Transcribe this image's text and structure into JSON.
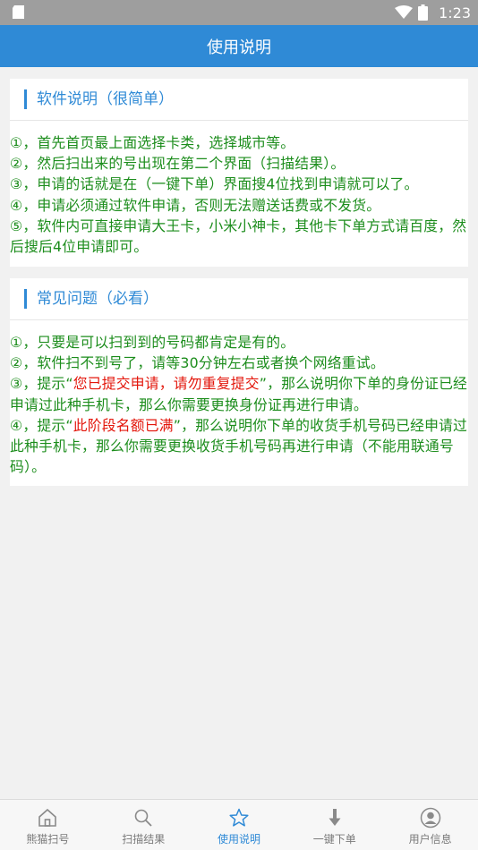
{
  "status_bar": {
    "time": "1:23",
    "icons": [
      "sd-card-icon",
      "wifi-icon",
      "battery-icon"
    ]
  },
  "app_bar": {
    "title": "使用说明"
  },
  "sections": [
    {
      "title": "软件说明（很简单）",
      "items": [
        "①，首先首页最上面选择卡类，选择城市等。",
        "②，然后扫出来的号出现在第二个界面（扫描结果）。",
        "③，申请的话就是在（一键下单）界面搜4位找到申请就可以了。",
        "④，申请必须通过软件申请，否则无法赠送话费或不发货。",
        "⑤，软件内可直接申请大王卡，小米小神卡，其他卡下单方式请百度，然后搜后4位申请即可。"
      ]
    },
    {
      "title": "常见问题（必看）",
      "items": [
        "①，只要是可以扫到到的号码都肯定是有的。",
        "②，软件扫不到号了，请等30分钟左右或者换个网络重试。"
      ],
      "item3": {
        "prefix": "③，提示“",
        "highlight": "您已提交申请，请勿重复提交",
        "suffix": "”，那么说明你下单的身份证已经申请过此种手机卡，那么你需要更换身份证再进行申请。"
      },
      "item4": {
        "prefix": "④，提示“",
        "highlight": "此阶段名额已满",
        "suffix": "”，那么说明你下单的收货手机号码已经申请过此种手机卡，那么你需要更换收货手机号码再进行申请（不能用联通号码）。"
      }
    }
  ],
  "bottom_nav": {
    "items": [
      {
        "label": "熊猫扫号",
        "icon": "home-icon",
        "active": false
      },
      {
        "label": "扫描结果",
        "icon": "search-icon",
        "active": false
      },
      {
        "label": "使用说明",
        "icon": "star-icon",
        "active": true
      },
      {
        "label": "一键下单",
        "icon": "download-arrow-icon",
        "active": false
      },
      {
        "label": "用户信息",
        "icon": "user-icon",
        "active": false
      }
    ]
  },
  "colors": {
    "primary": "#2f8ad6",
    "text_green": "#1c8d1c",
    "highlight_red": "#e3160b",
    "status_bar": "#9e9e9e",
    "background": "#f1f1f1",
    "nav_inactive": "#7a7a7a"
  }
}
